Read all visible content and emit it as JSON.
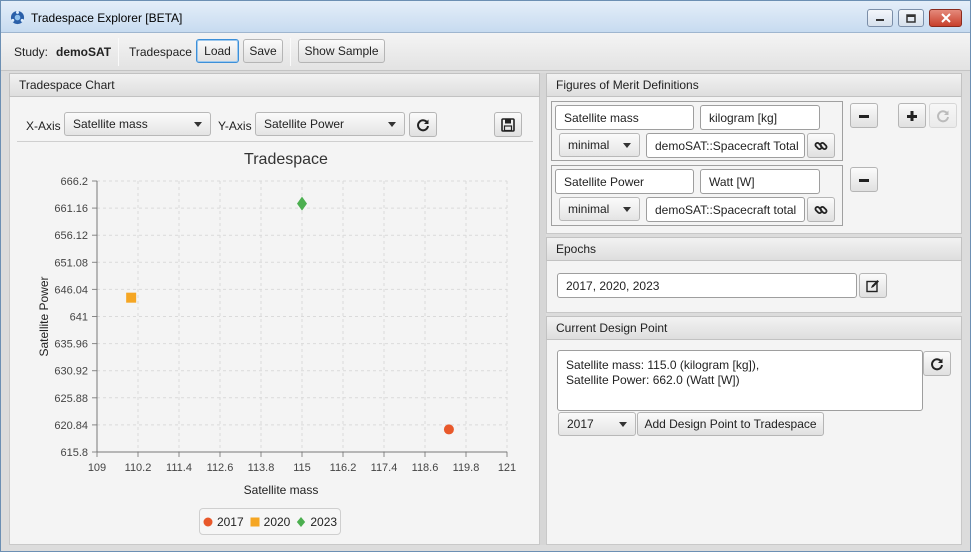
{
  "window": {
    "title": "Tradespace Explorer [BETA]"
  },
  "toolbar": {
    "study_label": "Study:",
    "study_name": "demoSAT",
    "tradespace_label": "Tradespace",
    "load_label": "Load",
    "save_label": "Save",
    "show_sample_label": "Show Sample"
  },
  "chart_panel": {
    "title": "Tradespace Chart",
    "x_axis_label": "X-Axis",
    "x_axis_value": "Satellite mass",
    "y_axis_label": "Y-Axis",
    "y_axis_value": "Satellite Power"
  },
  "chart_data": {
    "type": "scatter",
    "title": "Tradespace",
    "xlabel": "Satellite mass",
    "ylabel": "Satellite Power",
    "xlim": [
      109,
      121
    ],
    "ylim": [
      615.8,
      666.2
    ],
    "x_ticks": [
      "109",
      "110.2",
      "111.4",
      "112.6",
      "113.8",
      "115",
      "116.2",
      "117.4",
      "118.6",
      "119.8",
      "121"
    ],
    "y_ticks": [
      "666.2",
      "661.16",
      "656.12",
      "651.08",
      "646.04",
      "641",
      "635.96",
      "630.92",
      "625.88",
      "620.84",
      "615.8"
    ],
    "grid": true,
    "legend_position": "bottom",
    "series": [
      {
        "name": "2017",
        "marker": "circle",
        "color": "#e8582a",
        "points": [
          [
            119.3,
            620.0
          ]
        ]
      },
      {
        "name": "2020",
        "marker": "square",
        "color": "#f5a623",
        "points": [
          [
            110.0,
            644.5
          ]
        ]
      },
      {
        "name": "2023",
        "marker": "diamond",
        "color": "#4caf50",
        "points": [
          [
            115.0,
            662.0
          ]
        ]
      }
    ]
  },
  "fom_panel": {
    "title": "Figures of Merit Definitions",
    "items": [
      {
        "name": "Satellite mass",
        "unit": "kilogram [kg]",
        "optimality": "minimal",
        "source": "demoSAT::Spacecraft Total"
      },
      {
        "name": "Satellite Power",
        "unit": "Watt [W]",
        "optimality": "minimal",
        "source": "demoSAT::Spacecraft total"
      }
    ]
  },
  "epochs_panel": {
    "title": "Epochs",
    "value": "2017, 2020, 2023"
  },
  "design_point_panel": {
    "title": "Current Design Point",
    "line1": "Satellite mass: 115.0 (kilogram [kg]),",
    "line2": "Satellite Power: 662.0 (Watt [W])",
    "epoch_value": "2017",
    "add_button_label": "Add Design Point to Tradespace"
  }
}
